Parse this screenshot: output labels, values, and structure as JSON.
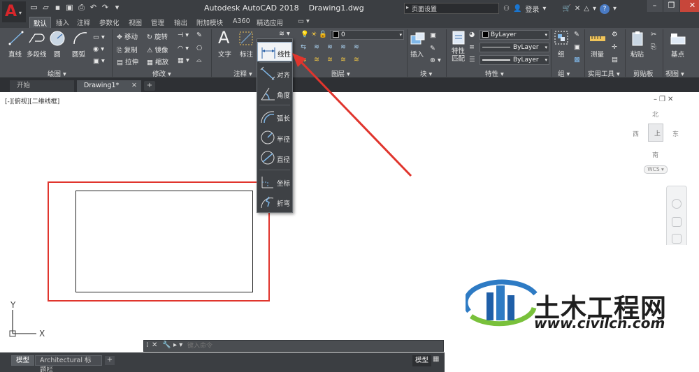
{
  "titlebar": {
    "app_name": "Autodesk AutoCAD 2018",
    "document": "Drawing1.dwg",
    "search_value": "页面设置",
    "login_label": "登录",
    "help_label": "?"
  },
  "ribbon_tabs": [
    "默认",
    "插入",
    "注释",
    "参数化",
    "视图",
    "管理",
    "输出",
    "附加模块",
    "A360",
    "精选应用"
  ],
  "ribbon": {
    "draw": {
      "title": "绘图",
      "items": [
        "直线",
        "多段线",
        "圆",
        "圆弧"
      ]
    },
    "modify": {
      "title": "修改",
      "items": [
        "移动",
        "旋转",
        "复制",
        "镜像",
        "拉伸",
        "缩放"
      ]
    },
    "annotation": {
      "title": "注释",
      "items": [
        "文字",
        "标注"
      ]
    },
    "layers": {
      "title": "图层",
      "layer_value": "0"
    },
    "block": {
      "title": "块",
      "items": [
        "插入"
      ]
    },
    "properties": {
      "title": "特性",
      "match_label": "特性\n匹配",
      "bylayer": "ByLayer"
    },
    "group": {
      "title": "组",
      "items": [
        "组"
      ]
    },
    "utilities": {
      "title": "实用工具",
      "items": [
        "测量"
      ]
    },
    "clipboard": {
      "title": "剪贴板",
      "items": [
        "粘贴"
      ]
    },
    "view": {
      "title": "视图",
      "items": [
        "基点"
      ]
    }
  },
  "doc_tabs": {
    "start": "开始",
    "drawing": "Drawing1*"
  },
  "viewport_label": "[-][俯视][二维线框]",
  "viewcube": {
    "north": "北",
    "south": "南",
    "west": "西",
    "east": "东",
    "wcs": "WCS"
  },
  "ucs": {
    "x": "X",
    "y": "Y"
  },
  "flyout": [
    {
      "label": "线性",
      "active": true
    },
    {
      "label": "对齐",
      "active": false
    },
    {
      "label": "角度",
      "active": false
    },
    {
      "label": "弧长",
      "active": false
    },
    {
      "label": "半径",
      "active": false
    },
    {
      "label": "直径",
      "active": false
    },
    {
      "label": "坐标",
      "active": false
    },
    {
      "label": "折弯",
      "active": false
    }
  ],
  "command_line": {
    "placeholder": "键入命令"
  },
  "status": {
    "layout_tabs": [
      "模型",
      "Architectural 标题栏"
    ],
    "model_label": "模型"
  },
  "watermark": {
    "cn": "土木工程网",
    "url": "www.civilcn.com"
  },
  "colors": {
    "accent_red": "#e0352d",
    "ribbon_bg": "#4d5055",
    "title_bg": "#3b3e42"
  }
}
